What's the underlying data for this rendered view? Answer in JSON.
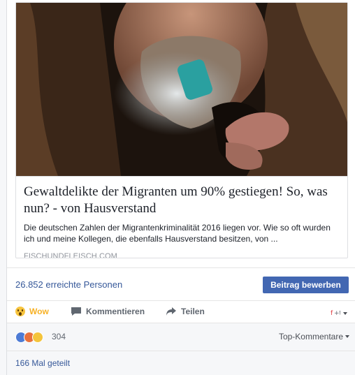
{
  "link": {
    "title": "Gewaltdelikte der Migranten um 90% gestiegen! So, was nun? - von Hausverstand",
    "description": "Die deutschen Zahlen der Migrantenkriminalität 2016 liegen vor. Wie so oft wurden ich und meine Kollegen, die ebenfalls Hausverstand besitzen, von ...",
    "domain": "FISCHUNDFLEISCH.COM"
  },
  "insights": {
    "reach": "26.852 erreichte Personen",
    "promote_label": "Beitrag bewerben"
  },
  "actions": {
    "wow_label": "Wow",
    "comment_label": "Kommentieren",
    "share_label": "Teilen"
  },
  "reactions": {
    "icons": [
      "like-reaction",
      "angry-reaction",
      "sad-reaction"
    ],
    "count": "304",
    "sort_label": "Top-Kommentare"
  },
  "shares": {
    "label": "166 Mal geteilt"
  },
  "colors": {
    "link_blue": "#365899",
    "button_blue": "#4267b2",
    "wow_yellow": "#f7b125"
  }
}
